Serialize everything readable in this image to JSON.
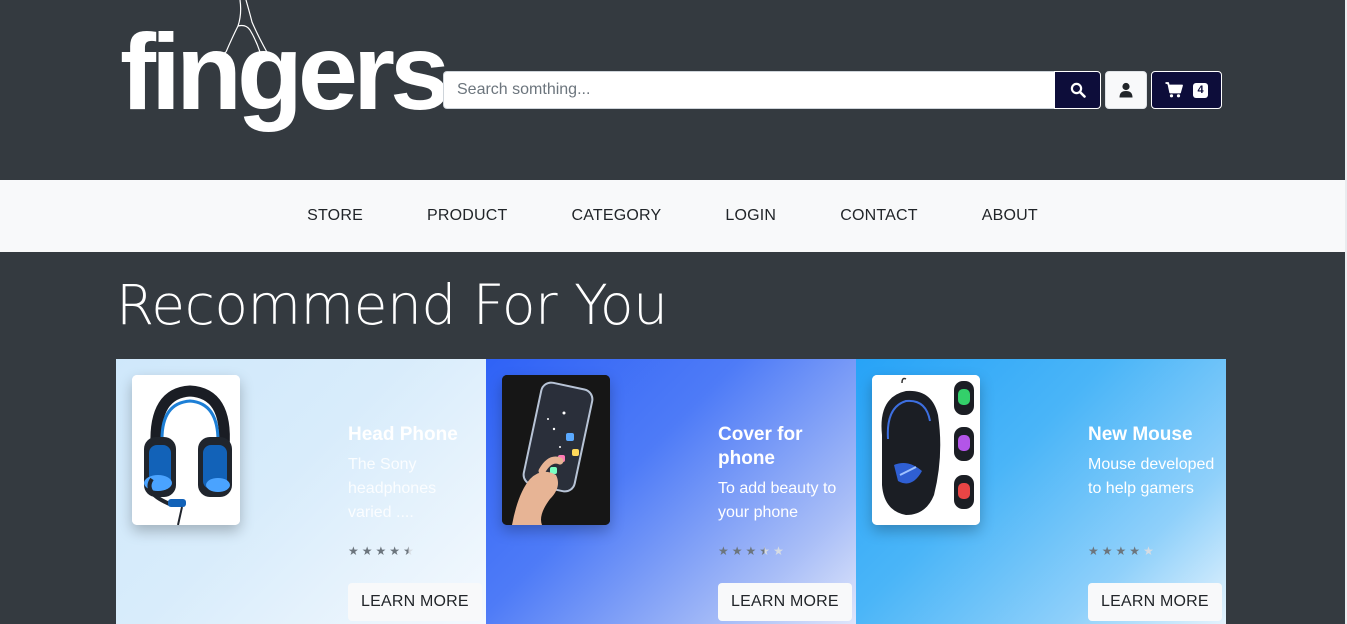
{
  "brand": {
    "logo_text": "fingers"
  },
  "search": {
    "placeholder": "Search somthing...",
    "button_icon": "search-icon"
  },
  "header_actions": {
    "user_icon": "user-icon",
    "cart_icon": "cart-icon",
    "cart_count": "4"
  },
  "nav": {
    "items": [
      {
        "label": "STORE"
      },
      {
        "label": "PRODUCT"
      },
      {
        "label": "CATEGORY"
      },
      {
        "label": "LOGIN"
      },
      {
        "label": "CONTACT"
      },
      {
        "label": "ABOUT"
      }
    ]
  },
  "section": {
    "title": "Recommend For You"
  },
  "cards": [
    {
      "title": "Head Phone",
      "description": "The Sony headphones varied ....",
      "rating": 4.5,
      "button_label": "LEARN MORE",
      "image": "headphone-image"
    },
    {
      "title": "Cover for phone",
      "description": "To add beauty to your phone",
      "rating": 3.5,
      "button_label": "LEARN MORE",
      "image": "phone-cover-image"
    },
    {
      "title": "New Mouse",
      "description": "Mouse developed to help gamers",
      "rating": 4,
      "button_label": "LEARN MORE",
      "image": "gaming-mouse-image"
    }
  ],
  "colors": {
    "page_bg": "#343a40",
    "nav_bg": "#f8f9fa",
    "button_dark": "#0d0d3a",
    "star": "#6c757d"
  }
}
